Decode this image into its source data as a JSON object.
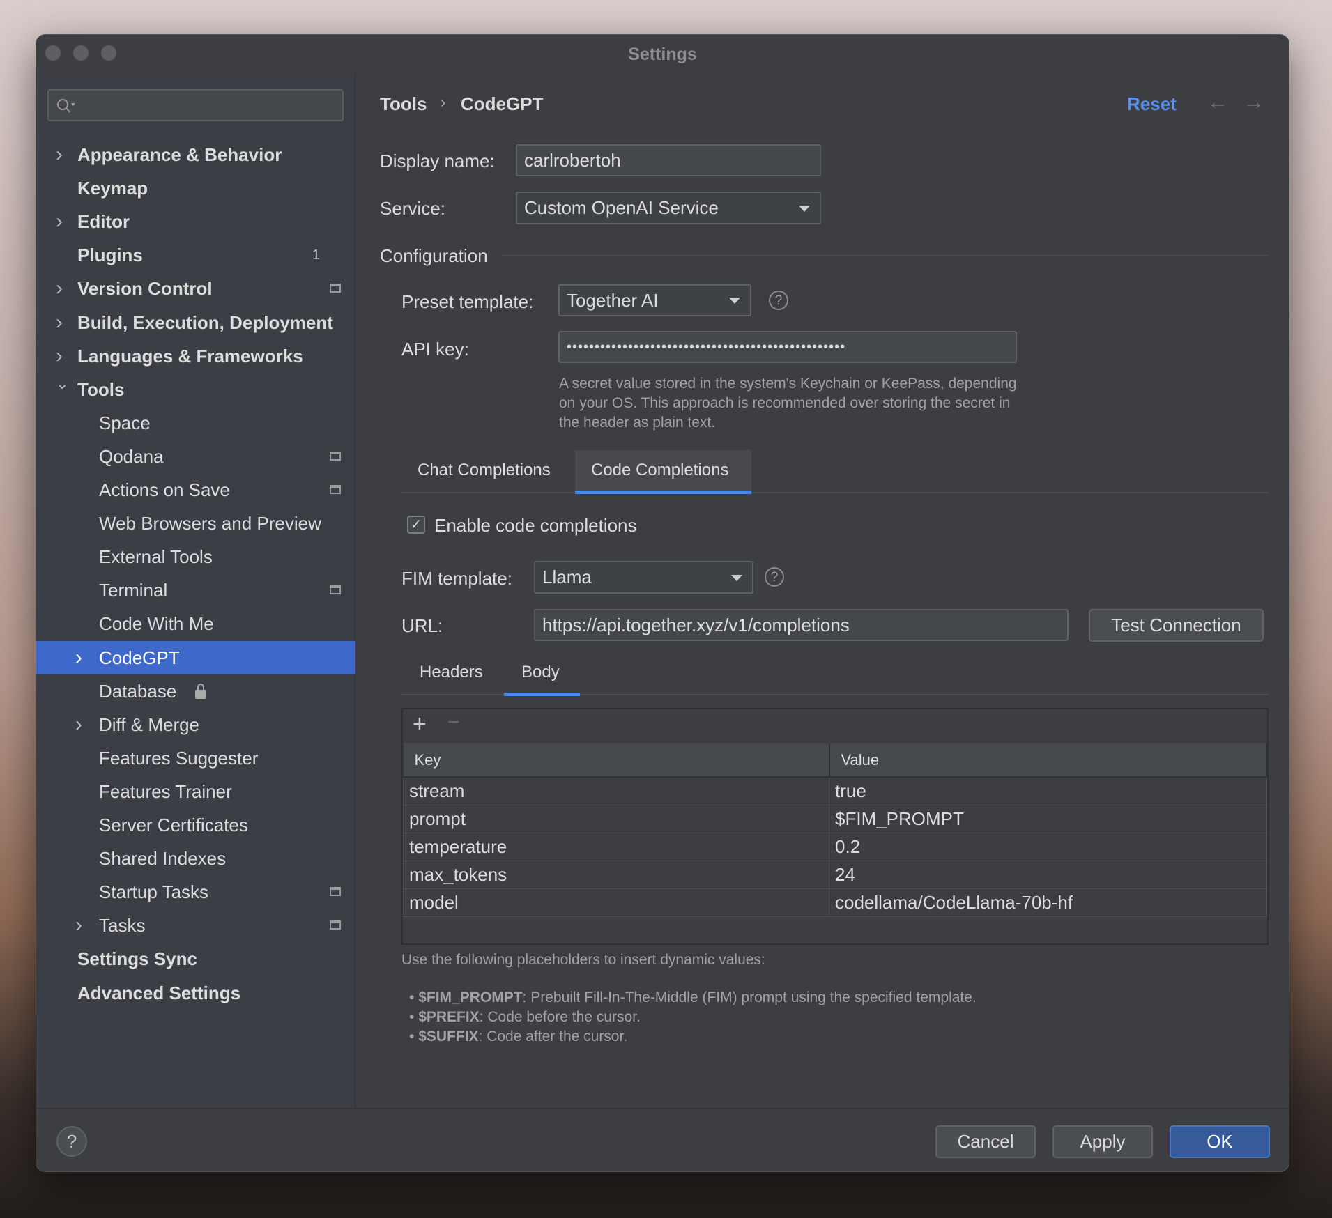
{
  "window": {
    "title": "Settings"
  },
  "sidebar": {
    "search_placeholder": "",
    "items": [
      {
        "label": "Appearance & Behavior",
        "level": 1,
        "chevron": "right",
        "bold": true
      },
      {
        "label": "Keymap",
        "level": 1,
        "bold": true
      },
      {
        "label": "Editor",
        "level": 1,
        "chevron": "right",
        "bold": true
      },
      {
        "label": "Plugins",
        "level": 1,
        "bold": true,
        "badge": "1"
      },
      {
        "label": "Version Control",
        "level": 1,
        "chevron": "right",
        "bold": true,
        "pin": true
      },
      {
        "label": "Build, Execution, Deployment",
        "level": 1,
        "chevron": "right",
        "bold": true
      },
      {
        "label": "Languages & Frameworks",
        "level": 1,
        "chevron": "right",
        "bold": true
      },
      {
        "label": "Tools",
        "level": 1,
        "chevron": "down",
        "bold": true
      },
      {
        "label": "Space",
        "level": 2
      },
      {
        "label": "Qodana",
        "level": 2,
        "pin": true
      },
      {
        "label": "Actions on Save",
        "level": 2,
        "pin": true
      },
      {
        "label": "Web Browsers and Preview",
        "level": 2
      },
      {
        "label": "External Tools",
        "level": 2
      },
      {
        "label": "Terminal",
        "level": 2,
        "pin": true
      },
      {
        "label": "Code With Me",
        "level": 2
      },
      {
        "label": "CodeGPT",
        "level": 2,
        "chevron": "right",
        "selected": true
      },
      {
        "label": "Database",
        "level": 2,
        "lock": true
      },
      {
        "label": "Diff & Merge",
        "level": 2,
        "chevron": "right"
      },
      {
        "label": "Features Suggester",
        "level": 2
      },
      {
        "label": "Features Trainer",
        "level": 2
      },
      {
        "label": "Server Certificates",
        "level": 2
      },
      {
        "label": "Shared Indexes",
        "level": 2
      },
      {
        "label": "Startup Tasks",
        "level": 2,
        "pin": true
      },
      {
        "label": "Tasks",
        "level": 2,
        "chevron": "right",
        "pin": true
      },
      {
        "label": "Settings Sync",
        "level": 1,
        "bold": true
      },
      {
        "label": "Advanced Settings",
        "level": 1,
        "bold": true
      }
    ]
  },
  "header": {
    "breadcrumb": [
      "Tools",
      "CodeGPT"
    ],
    "reset": "Reset"
  },
  "form": {
    "display_name_label": "Display name:",
    "display_name": "carlrobertoh",
    "service_label": "Service:",
    "service": "Custom OpenAI Service",
    "configuration": "Configuration",
    "preset_label": "Preset template:",
    "preset": "Together AI",
    "api_key_label": "API key:",
    "api_key_masked": "••••••••••••••••••••••••••••••••••••••••••••••••••",
    "api_hint": [
      "A secret value stored in the system's Keychain or KeePass, depending",
      "on your OS. This approach is recommended over storing the secret in",
      "the header as plain text."
    ]
  },
  "tabs": [
    "Chat Completions",
    "Code Completions"
  ],
  "active_tab": "Code Completions",
  "code": {
    "enable_label": "Enable code completions",
    "enabled": true,
    "fim_label": "FIM template:",
    "fim": "Llama",
    "url_label": "URL:",
    "url": "https://api.together.xyz/v1/completions",
    "test_button": "Test Connection",
    "subtabs": [
      "Headers",
      "Body"
    ],
    "active_subtab": "Body",
    "table": {
      "columns": [
        "Key",
        "Value"
      ],
      "rows": [
        [
          "stream",
          "true"
        ],
        [
          "prompt",
          "$FIM_PROMPT"
        ],
        [
          "temperature",
          "0.2"
        ],
        [
          "max_tokens",
          "24"
        ],
        [
          "model",
          "codellama/CodeLlama-70b-hf"
        ]
      ]
    },
    "placeholder_intro": "Use the following placeholders to insert dynamic values:",
    "placeholders": [
      {
        "name": "$FIM_PROMPT",
        "desc": ": Prebuilt Fill-In-The-Middle (FIM) prompt using the specified template."
      },
      {
        "name": "$PREFIX",
        "desc": ": Code before the cursor."
      },
      {
        "name": "$SUFFIX",
        "desc": ": Code after the cursor."
      }
    ]
  },
  "footer": {
    "help": "?",
    "cancel": "Cancel",
    "apply": "Apply",
    "ok": "OK"
  },
  "colors": {
    "accent": "#3e68c9",
    "link": "#5a8ff0"
  }
}
